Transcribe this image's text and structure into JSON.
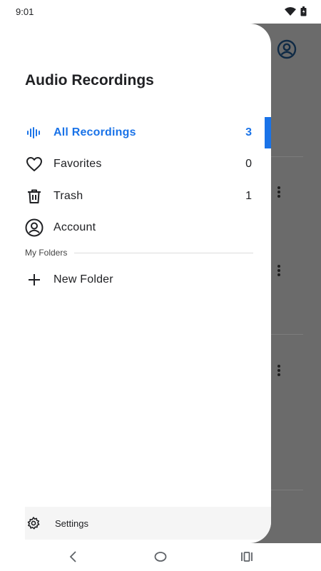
{
  "status_bar": {
    "time": "9:01"
  },
  "drawer": {
    "title": "Audio Recordings",
    "items": [
      {
        "label": "All Recordings",
        "count": "3",
        "icon": "waveform-icon",
        "active": true
      },
      {
        "label": "Favorites",
        "count": "0",
        "icon": "heart-icon"
      },
      {
        "label": "Trash",
        "count": "1",
        "icon": "trash-icon"
      },
      {
        "label": "Account",
        "icon": "account-icon"
      }
    ],
    "folders_header": "My Folders",
    "new_folder_label": "New Folder",
    "settings_label": "Settings"
  },
  "colors": {
    "accent": "#1a73e8",
    "scrim": "#6b6b6b"
  }
}
